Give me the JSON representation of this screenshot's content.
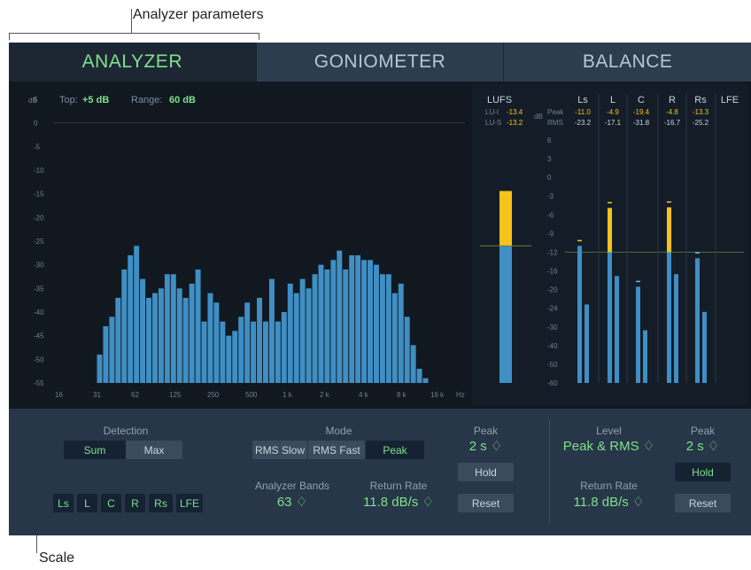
{
  "callouts": {
    "top": "Analyzer parameters",
    "bottom": "Scale"
  },
  "tabs": [
    {
      "label": "ANALYZER",
      "active": true
    },
    {
      "label": "GONIOMETER",
      "active": false
    },
    {
      "label": "BALANCE",
      "active": false
    }
  ],
  "analyzer": {
    "db_label": "dB",
    "top_label": "Top:",
    "top_value": "+5 dB",
    "range_label": "Range:",
    "range_value": "60 dB",
    "y_ticks": [
      "5",
      "0",
      "-5",
      "-10",
      "-15",
      "-20",
      "-25",
      "-30",
      "-35",
      "-40",
      "-45",
      "-50",
      "-55"
    ],
    "x_ticks": [
      "16",
      "31",
      "62",
      "125",
      "250",
      "500",
      "1 k",
      "2 k",
      "4 k",
      "8 k",
      "16 k",
      "Hz"
    ],
    "band_levels_db": [
      -49,
      -43,
      -41,
      -37,
      -31,
      -28,
      -26,
      -33,
      -37,
      -36,
      -35,
      -32,
      -32,
      -35,
      -37,
      -34,
      -31,
      -42,
      -36,
      -38,
      -42,
      -45,
      -44,
      -41,
      -38,
      -42,
      -37,
      -42,
      -33,
      -42,
      -40,
      -34,
      -36,
      -33,
      -35,
      -32,
      -30,
      -31,
      -29,
      -27,
      -31,
      -28,
      -28,
      -29,
      -29,
      -30,
      -32,
      -32,
      -36,
      -34,
      -41,
      -47,
      -52,
      -54
    ],
    "colors": {
      "bar": "#3f8fc5",
      "bar_edge": "#2a6a98",
      "accent": "#7fe08d",
      "peak_yellow": "#f5c31a"
    }
  },
  "meters": {
    "lufs_label": "LUFS",
    "lu_i_label": "LU-I",
    "lu_i_value": "-13.4",
    "lu_s_label": "LU-S",
    "lu_s_value": "-13.2",
    "lufs_level": -13.4,
    "lufs_peak_level": -11,
    "db_label": "dB",
    "peak_label": "Peak",
    "rms_label": "RMS",
    "scale": [
      "6",
      "3",
      "0",
      "-3",
      "-6",
      "-9",
      "-12",
      "-16",
      "-20",
      "-24",
      "-30",
      "-40",
      "-50",
      "-60"
    ],
    "channels": [
      {
        "name": "Ls",
        "peak": "-11.0",
        "rms": "-23.2",
        "peak_level": -11.0,
        "rms_level": -23.2,
        "peak_over": false,
        "hold": true
      },
      {
        "name": "L",
        "peak": "-4.9",
        "rms": "-17.1",
        "peak_level": -4.9,
        "rms_level": -17.1,
        "peak_over": true,
        "hold": true
      },
      {
        "name": "C",
        "peak": "-19.4",
        "rms": "-31.8",
        "peak_level": -19.4,
        "rms_level": -31.8,
        "peak_over": false,
        "hold": true
      },
      {
        "name": "R",
        "peak": "-4.8",
        "rms": "-16.7",
        "peak_level": -4.8,
        "rms_level": -16.7,
        "peak_over": true,
        "hold": true
      },
      {
        "name": "Rs",
        "peak": "-13.3",
        "rms": "-25.2",
        "peak_level": -13.3,
        "rms_level": -25.2,
        "peak_over": false,
        "hold": true
      },
      {
        "name": "LFE",
        "peak": "",
        "rms": "",
        "peak_level": null,
        "rms_level": null,
        "peak_over": false,
        "hold": false
      }
    ]
  },
  "controls": {
    "detection": {
      "label": "Detection",
      "options": [
        "Sum",
        "Max"
      ],
      "selected": "Sum"
    },
    "channels": [
      "Ls",
      "L",
      "C",
      "R",
      "Rs",
      "LFE"
    ],
    "mode": {
      "label": "Mode",
      "options": [
        "RMS Slow",
        "RMS Fast",
        "Peak"
      ],
      "selected": "Peak"
    },
    "analyzer_bands": {
      "label": "Analyzer Bands",
      "value": "63 ♢"
    },
    "return_rate_left": {
      "label": "Return Rate",
      "value": "11.8 dB/s ♢"
    },
    "peak_left": {
      "label": "Peak",
      "value": "2 s ♢",
      "hold": "Hold",
      "reset": "Reset"
    },
    "level": {
      "label": "Level",
      "value": "Peak & RMS ♢"
    },
    "return_rate_right": {
      "label": "Return Rate",
      "value": "11.8 dB/s ♢"
    },
    "peak_right": {
      "label": "Peak",
      "value": "2 s ♢",
      "hold": "Hold",
      "reset": "Reset"
    }
  }
}
